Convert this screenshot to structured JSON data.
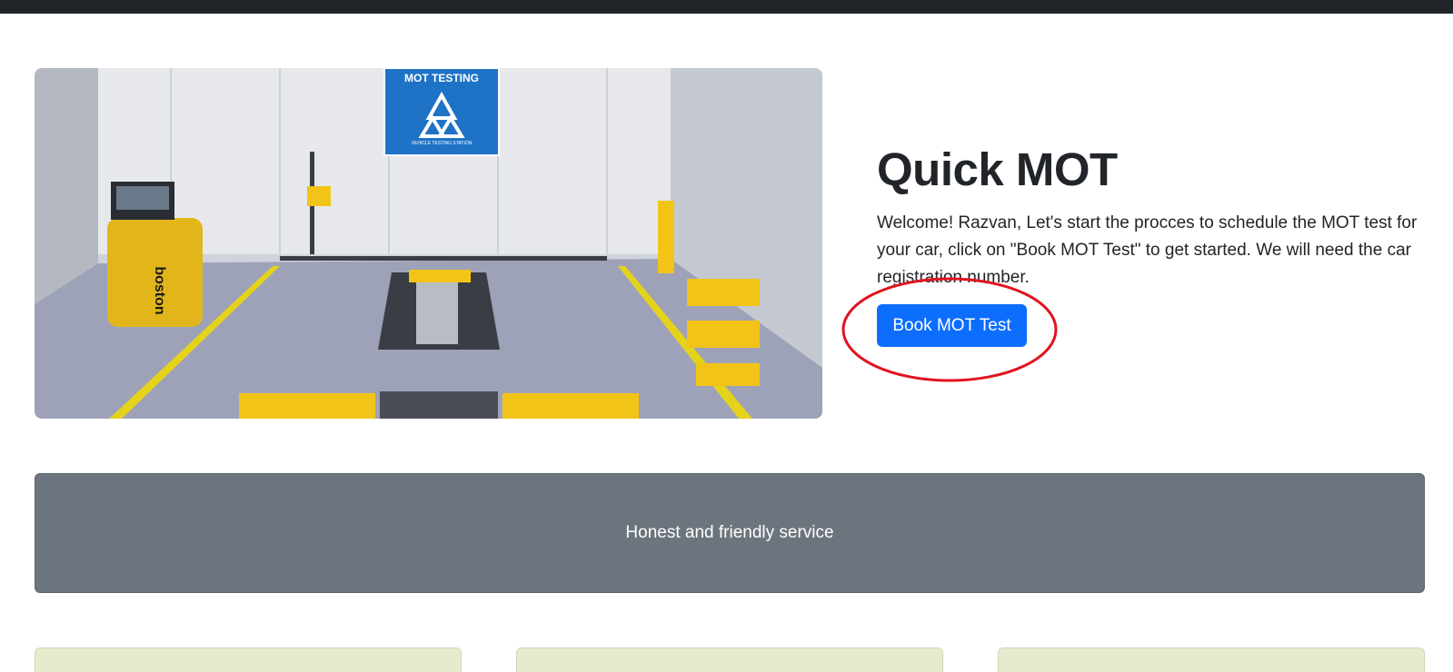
{
  "hero": {
    "image_alt": "MOT testing station",
    "sign_title": "MOT TESTING",
    "sign_subtitle": "VEHICLE TESTING STATION",
    "brand_text": "boston",
    "title": "Quick MOT",
    "description": "Welcome! Razvan, Let's start the procces to schedule the MOT test for your car, click on \"Book MOT Test\" to get started. We will need the car registration number.",
    "button_label": "Book MOT Test"
  },
  "banner": {
    "text": "Honest and friendly service"
  },
  "colors": {
    "navbar": "#212529",
    "primary": "#0d6efd",
    "banner": "#6c757d",
    "card": "#e5ebcc",
    "annotation": "#e0141e"
  },
  "cards": [
    {
      "name": "card-1"
    },
    {
      "name": "card-2"
    },
    {
      "name": "card-3"
    }
  ]
}
